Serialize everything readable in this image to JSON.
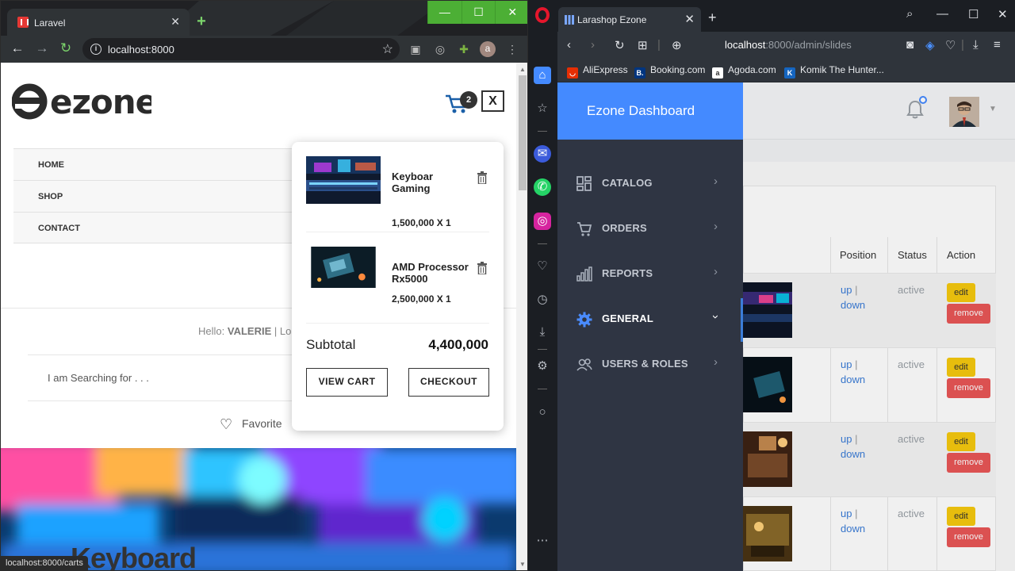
{
  "left_window": {
    "tab_title": "Laravel",
    "url": "localhost:8000",
    "avatar_letter": "a",
    "window_controls": {
      "minimize": "—",
      "maximize": "☐",
      "close": "✕"
    }
  },
  "shop": {
    "logo_text": "ezone",
    "cart_count": "2",
    "close_label": "X",
    "nav": [
      "HOME",
      "SHOP",
      "CONTACT"
    ],
    "hello_label": "Hello:",
    "hello_user": "VALERIE",
    "hello_after": "|  Lo",
    "search_placeholder": "I am Searching for . . .",
    "favorites_label": "Favorite",
    "hero_title": "Keyboard",
    "status_url": "localhost:8000/carts"
  },
  "minicart": {
    "items": [
      {
        "name": "Keyboar Gaming",
        "price": "1,500,000 X 1"
      },
      {
        "name": "AMD Processor Rx5000",
        "price": "2,500,000 X 1"
      }
    ],
    "subtotal_label": "Subtotal",
    "subtotal_value": "4,400,000",
    "view_cart_label": "VIEW CART",
    "checkout_label": "CHECKOUT"
  },
  "right_window": {
    "tab_title": "Larashop Ezone",
    "url_host": "localhost",
    "url_rest": ":8000/admin/slides",
    "bookmarks": [
      "AliExpress",
      "Booking.com",
      "Agoda.com",
      "Komik The Hunter..."
    ]
  },
  "admin": {
    "brand": "Ezone Dashboard",
    "menu": [
      {
        "label": "CATALOG"
      },
      {
        "label": "ORDERS"
      },
      {
        "label": "REPORTS"
      },
      {
        "label": "GENERAL"
      },
      {
        "label": "USERS & ROLES"
      }
    ],
    "columns": {
      "position": "Position",
      "status": "Status",
      "action": "Action"
    },
    "rows": [
      {
        "up": "up",
        "sep": "|",
        "down": "down",
        "status": "active",
        "edit": "edit",
        "remove": "remove"
      },
      {
        "up": "up",
        "sep": "|",
        "down": "down",
        "status": "active",
        "edit": "edit",
        "remove": "remove"
      },
      {
        "up": "up",
        "sep": "|",
        "down": "down",
        "status": "active",
        "edit": "edit",
        "remove": "remove"
      },
      {
        "up": "up",
        "sep": "|",
        "down": "down",
        "status": "active",
        "edit": "edit",
        "remove": "remove"
      }
    ]
  },
  "colors": {
    "admin_brand_blue": "#448aff",
    "sidebar_dark": "#2f3543",
    "edit_yellow": "#f6c90e",
    "remove_red": "#e95757",
    "chrome_green": "#4caf35",
    "opera_red": "#e5162c"
  }
}
